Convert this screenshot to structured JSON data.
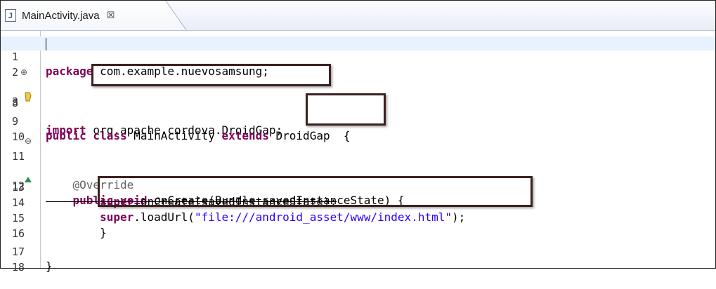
{
  "tab": {
    "icon": "java-file-icon",
    "title": "MainActivity.java",
    "close_glyph": "☒"
  },
  "lines": [
    {
      "num": "1",
      "text": "package com.example.nuevosamsung;"
    },
    {
      "num": "2",
      "text": ""
    },
    {
      "num": "3",
      "fold": "⊕",
      "kw": "import",
      "text": " org.apache.cordova.DroidGap;"
    },
    {
      "num": "8",
      "text": ""
    },
    {
      "num": "9",
      "kw": "public class",
      "text1": " MainActivity ",
      "kw2": "extends",
      "text2": " DroidGap  {"
    },
    {
      "num": "10",
      "text": ""
    },
    {
      "num": "11",
      "fold": "⊖",
      "text": "    @Override"
    },
    {
      "num": "12",
      "kw": "public void",
      "text": " onCreate(Bundle savedInstanceState) {"
    },
    {
      "num": "13",
      "kw": "super",
      "text": ".onCreate(savedInstanceState);"
    },
    {
      "num": "14",
      "kw": "super",
      "text": ".loadUrl(",
      "str": "\"file:///android_asset/www/index.html\"",
      "tail": ");"
    },
    {
      "num": "15",
      "text": "}"
    },
    {
      "num": "16",
      "text": ""
    },
    {
      "num": "17",
      "text": "}"
    },
    {
      "num": "18",
      "text": ""
    }
  ]
}
